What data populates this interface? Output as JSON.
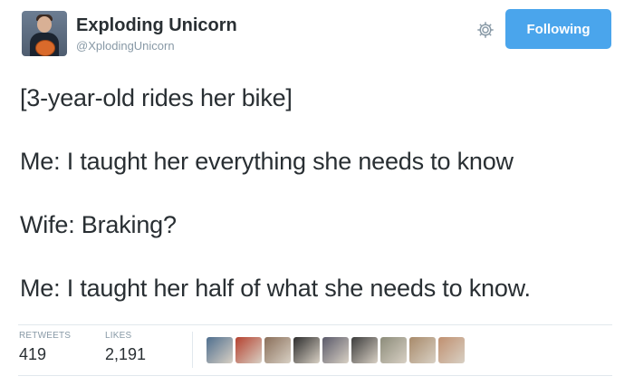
{
  "author": {
    "display_name": "Exploding Unicorn",
    "handle": "@XplodingUnicorn",
    "avatar_icon": "profile-photo"
  },
  "actions": {
    "settings_icon": "gear-icon",
    "follow_label": "Following",
    "follow_color": "#4aa5ec"
  },
  "tweet": {
    "lines": [
      "[3-year-old rides her bike]",
      "Me: I taught her everything she needs to know",
      "Wife: Braking?",
      "Me: I taught her half of what she needs to know."
    ]
  },
  "stats": {
    "retweets_label": "RETWEETS",
    "retweets_value": "419",
    "likes_label": "LIKES",
    "likes_value": "2,191"
  },
  "likers": {
    "avatar_colors": [
      "#4f6f8f",
      "#b5412f",
      "#8a6f5a",
      "#2d2d2d",
      "#5a5a6a",
      "#3c3c3c",
      "#8c8c7a",
      "#a88a6a",
      "#c09070"
    ]
  },
  "theme": {
    "text_color": "#292f33",
    "muted_color": "#8899a6",
    "divider_color": "#e1e8ed"
  }
}
